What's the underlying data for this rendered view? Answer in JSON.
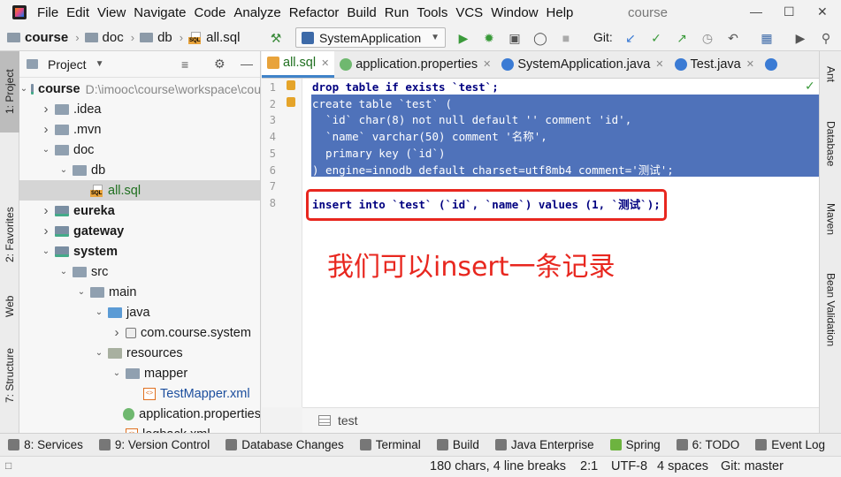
{
  "menubar": {
    "items": [
      "File",
      "Edit",
      "View",
      "Navigate",
      "Code",
      "Analyze",
      "Refactor",
      "Build",
      "Run",
      "Tools",
      "VCS",
      "Window",
      "Help"
    ],
    "window_title": "course"
  },
  "navbar": {
    "breadcrumbs": [
      "course",
      "doc",
      "db",
      "all.sql"
    ],
    "run_config": "SystemApplication",
    "git_label": "Git:"
  },
  "left_strip": {
    "tabs": [
      "1: Project",
      "2: Favorites",
      "Web",
      "7: Structure"
    ]
  },
  "project_panel": {
    "title": "Project",
    "tree": [
      {
        "label": "course",
        "path": "D:\\imooc\\course\\workspace\\cou",
        "depth": 0,
        "expanded": true,
        "kind": "module",
        "bold": true
      },
      {
        "label": ".idea",
        "depth": 1,
        "expanded": false,
        "kind": "folder"
      },
      {
        "label": ".mvn",
        "depth": 1,
        "expanded": false,
        "kind": "folder"
      },
      {
        "label": "doc",
        "depth": 1,
        "expanded": true,
        "kind": "folder"
      },
      {
        "label": "db",
        "depth": 2,
        "expanded": true,
        "kind": "folder"
      },
      {
        "label": "all.sql",
        "depth": 3,
        "kind": "sql",
        "selected": true
      },
      {
        "label": "eureka",
        "depth": 1,
        "expanded": false,
        "kind": "module",
        "bold": true
      },
      {
        "label": "gateway",
        "depth": 1,
        "expanded": false,
        "kind": "module",
        "bold": true
      },
      {
        "label": "system",
        "depth": 1,
        "expanded": true,
        "kind": "module",
        "bold": true
      },
      {
        "label": "src",
        "depth": 2,
        "expanded": true,
        "kind": "folder"
      },
      {
        "label": "main",
        "depth": 3,
        "expanded": true,
        "kind": "folder"
      },
      {
        "label": "java",
        "depth": 4,
        "expanded": true,
        "kind": "source"
      },
      {
        "label": "com.course.system",
        "depth": 5,
        "expanded": false,
        "kind": "package"
      },
      {
        "label": "resources",
        "depth": 4,
        "expanded": true,
        "kind": "resources"
      },
      {
        "label": "mapper",
        "depth": 5,
        "expanded": true,
        "kind": "folder"
      },
      {
        "label": "TestMapper.xml",
        "depth": 6,
        "kind": "xml"
      },
      {
        "label": "application.properties",
        "depth": 5,
        "kind": "properties"
      },
      {
        "label": "logback.xml",
        "depth": 5,
        "kind": "xml"
      }
    ]
  },
  "editor_tabs": [
    {
      "label": "all.sql",
      "active": true,
      "icon": "sql-icon"
    },
    {
      "label": "application.properties",
      "active": false,
      "icon": "properties-icon"
    },
    {
      "label": "SystemApplication.java",
      "active": false,
      "icon": "class-icon"
    },
    {
      "label": "Test.java",
      "active": false,
      "icon": "class-icon"
    },
    {
      "label": "",
      "active": false,
      "icon": "class-icon"
    }
  ],
  "right_strip": {
    "tabs": [
      "Ant",
      "Database",
      "Maven",
      "Bean Validation"
    ]
  },
  "editor": {
    "line_numbers": [
      "1",
      "2",
      "3",
      "4",
      "5",
      "6",
      "7",
      "8"
    ],
    "lines": [
      "drop table if exists `test`;",
      "create table `test` (",
      "  `id` char(8) not null default '' comment 'id',",
      "  `name` varchar(50) comment '名称',",
      "  primary key (`id`)",
      ") engine=innodb default charset=utf8mb4 comment='测试';",
      "",
      "insert into `test` (`id`, `name`) values (1, `测试`);"
    ],
    "annotation": "我们可以insert一条记录",
    "breadcrumb": "test"
  },
  "bottom_bar": {
    "tools": [
      "8: Services",
      "9: Version Control",
      "Database Changes",
      "Terminal",
      "Build",
      "Java Enterprise",
      "Spring",
      "6: TODO",
      "Event Log"
    ]
  },
  "status_bar": {
    "chars": "180 chars, 4 line breaks",
    "position": "2:1",
    "encoding": "UTF-8",
    "indent": "4 spaces",
    "git_branch": "Git: master"
  },
  "colors": {
    "selection": "#4f72ba",
    "annotation_red": "#e8271f",
    "keyword": "#000080",
    "string": "#008000"
  }
}
